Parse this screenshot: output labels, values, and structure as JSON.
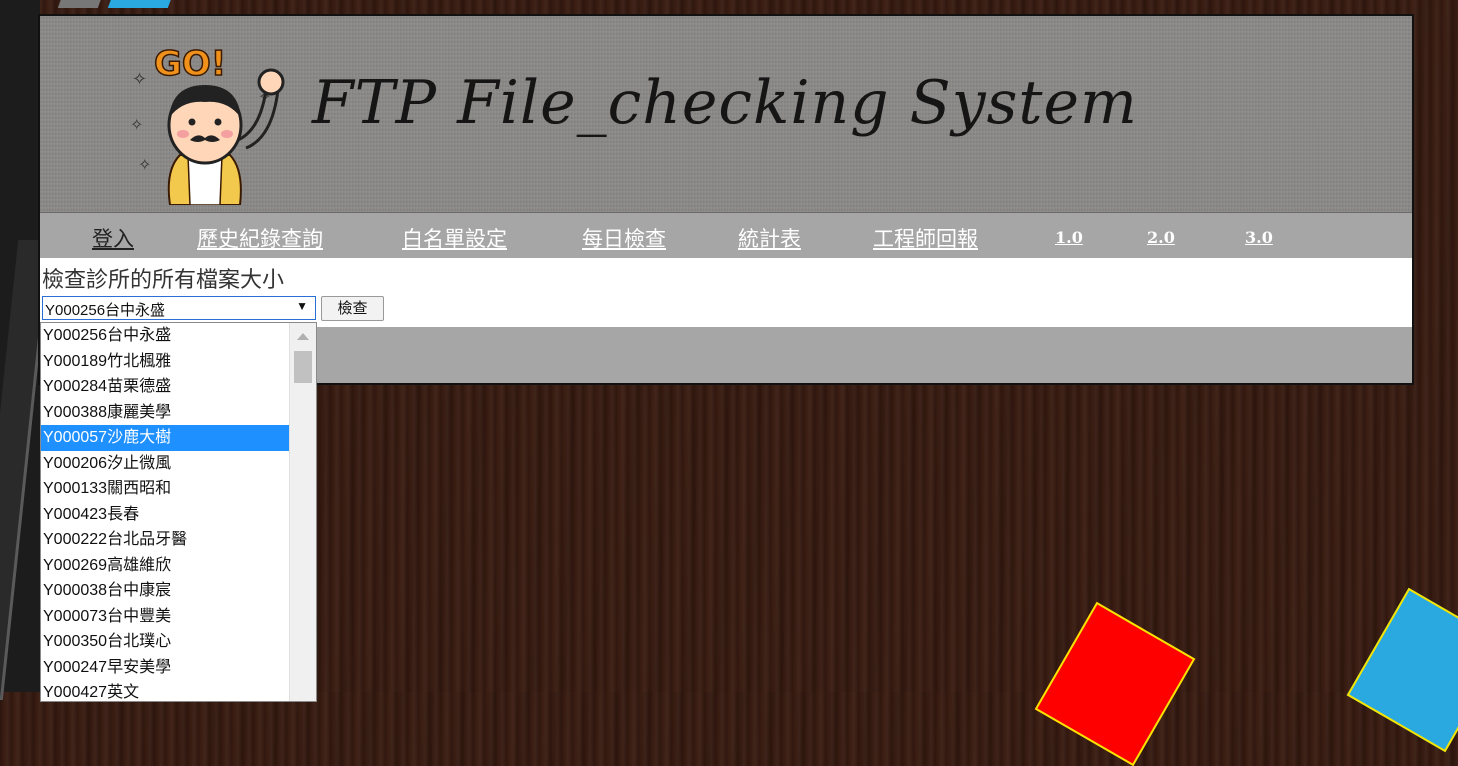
{
  "banner": {
    "title": "FTP File_checking System",
    "mascot_caption": "GO!"
  },
  "nav": {
    "items": [
      {
        "label": "登入"
      },
      {
        "label": "歷史紀錄查詢"
      },
      {
        "label": "白名單設定"
      },
      {
        "label": "每日檢查"
      },
      {
        "label": "統計表"
      },
      {
        "label": "工程師回報"
      },
      {
        "label": "1.0"
      },
      {
        "label": "2.0"
      },
      {
        "label": "3.0"
      }
    ]
  },
  "page": {
    "heading": "檢查診所的所有檔案大小",
    "select_value": "Y000256台中永盛",
    "check_button": "檢查"
  },
  "dropdown": {
    "selected_index": 4,
    "options": [
      "Y000256台中永盛",
      "Y000189竹北楓雅",
      "Y000284苗栗德盛",
      "Y000388康麗美學",
      "Y000057沙鹿大樹",
      "Y000206汐止微風",
      "Y000133關西昭和",
      "Y000423長春",
      "Y000222台北品牙醫",
      "Y000269高雄維欣",
      "Y000038台中康宸",
      "Y000073台中豐美",
      "Y000350台北璞心",
      "Y000247早安美學",
      "Y000427英文"
    ]
  },
  "colors": {
    "selection": "#1e90ff",
    "card_red": "#ff0000",
    "card_blue": "#2aa9e0",
    "card_border": "#f4e400"
  }
}
